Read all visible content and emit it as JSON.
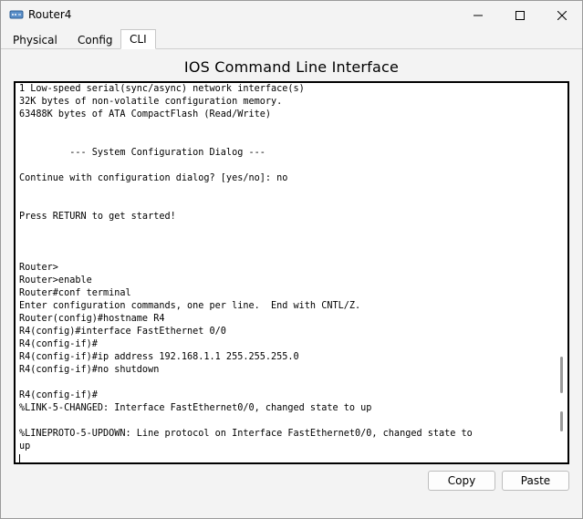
{
  "window": {
    "title": "Router4",
    "icons": {
      "app": "router-app-icon",
      "minimize": "minimize-icon",
      "maximize": "maximize-icon",
      "close": "close-icon"
    }
  },
  "tabs": [
    {
      "label": "Physical",
      "active": false
    },
    {
      "label": "Config",
      "active": false
    },
    {
      "label": "CLI",
      "active": true
    }
  ],
  "main": {
    "heading": "IOS Command Line Interface",
    "terminal_lines": [
      "1 Low-speed serial(sync/async) network interface(s)",
      "32K bytes of non-volatile configuration memory.",
      "63488K bytes of ATA CompactFlash (Read/Write)",
      "",
      "",
      "         --- System Configuration Dialog ---",
      "",
      "Continue with configuration dialog? [yes/no]: no",
      "",
      "",
      "Press RETURN to get started!",
      "",
      "",
      "",
      "Router>",
      "Router>enable",
      "Router#conf terminal",
      "Enter configuration commands, one per line.  End with CNTL/Z.",
      "Router(config)#hostname R4",
      "R4(config)#interface FastEthernet 0/0",
      "R4(config-if)#",
      "R4(config-if)#ip address 192.168.1.1 255.255.255.0",
      "R4(config-if)#no shutdown",
      "",
      "R4(config-if)#",
      "%LINK-5-CHANGED: Interface FastEthernet0/0, changed state to up",
      "",
      "%LINEPROTO-5-UPDOWN: Line protocol on Interface FastEthernet0/0, changed state to",
      "up"
    ]
  },
  "buttons": {
    "copy": "Copy",
    "paste": "Paste"
  },
  "colors": {
    "window_bg": "#f3f3f3",
    "terminal_bg": "#ffffff",
    "terminal_border": "#000000"
  }
}
